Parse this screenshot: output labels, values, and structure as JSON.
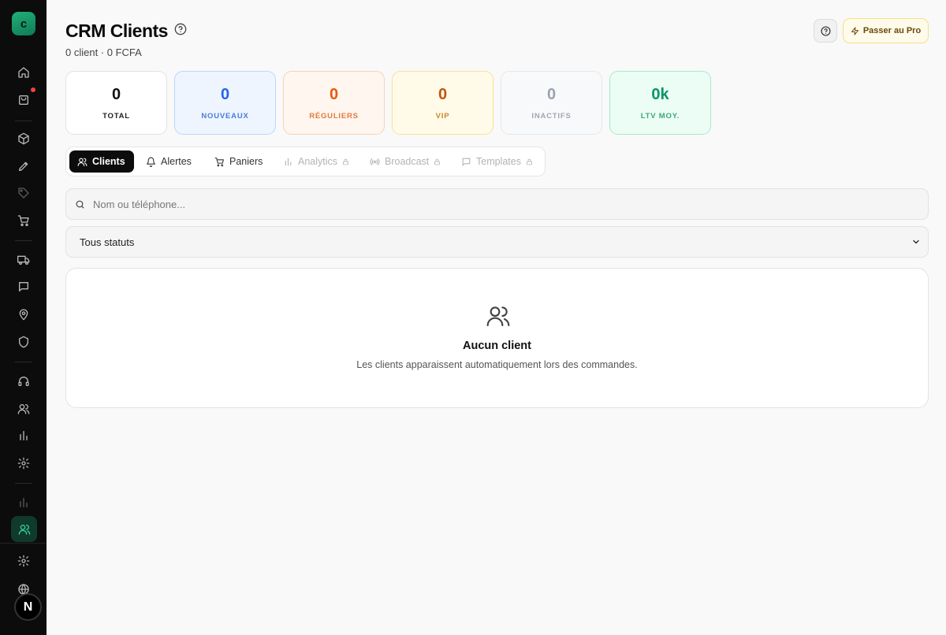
{
  "app": {
    "logo_letter": "c",
    "avatar_letter": "N"
  },
  "header": {
    "title": "CRM Clients",
    "subtitle": "0 client · 0 FCFA",
    "pro_button": "Passer au Pro"
  },
  "stats": [
    {
      "value": "0",
      "label": "TOTAL",
      "color": "#111111"
    },
    {
      "value": "0",
      "label": "NOUVEAUX",
      "color": "#2563eb"
    },
    {
      "value": "0",
      "label": "RÉGULIERS",
      "color": "#ea580c"
    },
    {
      "value": "0",
      "label": "VIP",
      "color": "#c2570c"
    },
    {
      "value": "0",
      "label": "INACTIFS",
      "color": "#9ca3af"
    },
    {
      "value": "0k",
      "label": "LTV MOY.",
      "color": "#059669"
    }
  ],
  "tabs": [
    {
      "label": "Clients",
      "icon": "users-icon",
      "active": true,
      "locked": false
    },
    {
      "label": "Alertes",
      "icon": "bell-icon",
      "active": false,
      "locked": false
    },
    {
      "label": "Paniers",
      "icon": "cart-icon",
      "active": false,
      "locked": false
    },
    {
      "label": "Analytics",
      "icon": "bar-chart-icon",
      "active": false,
      "locked": true
    },
    {
      "label": "Broadcast",
      "icon": "broadcast-icon",
      "active": false,
      "locked": true
    },
    {
      "label": "Templates",
      "icon": "message-icon",
      "active": false,
      "locked": true
    }
  ],
  "search": {
    "placeholder": "Nom ou téléphone..."
  },
  "filter": {
    "selected": "Tous statuts"
  },
  "empty_state": {
    "title": "Aucun client",
    "message": "Les clients apparaissent automatiquement lors des commandes."
  }
}
